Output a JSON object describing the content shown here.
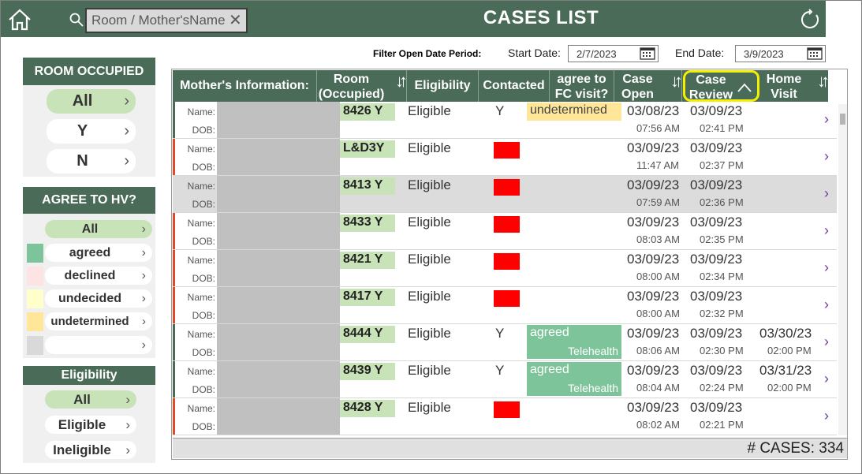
{
  "header": {
    "title": "CASES LIST",
    "search_placeholder": "Room / Mother'sName",
    "clear_glyph": "✕"
  },
  "filters": {
    "date_title": "Filter Open Date Period:",
    "start_label": "Start Date:",
    "start_value": "2/7/2023",
    "end_label": "End Date:",
    "end_value": "3/9/2023"
  },
  "panels": {
    "room": {
      "title": "ROOM OCCUPIED",
      "options": [
        "All",
        "Y",
        "N"
      ],
      "selected": "All"
    },
    "hv": {
      "title": "AGREE TO HV?",
      "options": [
        {
          "label": "All",
          "color": ""
        },
        {
          "label": "agreed",
          "color": "#7ec49a"
        },
        {
          "label": "declined",
          "color": "#fde3e3"
        },
        {
          "label": "undecided",
          "color": "#ffffcc"
        },
        {
          "label": "undetermined",
          "color": "#ffe699"
        },
        {
          "label": "",
          "color": "#d9d9d9"
        }
      ],
      "selected": "All"
    },
    "elig": {
      "title": "Eligibility",
      "options": [
        "All",
        "Eligible",
        "Ineligible"
      ],
      "selected": "All"
    }
  },
  "table": {
    "columns": [
      "Mother's Information:",
      "Room (Occupied)",
      "Eligibility",
      "Contacted",
      "agree to FC visit?",
      "Case Open",
      "Case Review",
      "Home Visit"
    ],
    "name_label": "Name:",
    "dob_label": "DOB:",
    "rows": [
      {
        "room": "8426 Y",
        "elig": "Eligible",
        "contacted": "Y",
        "fc": "undetermined",
        "fc_sub": "",
        "open_d": "03/08/23",
        "open_t": "07:56 AM",
        "rev_d": "03/09/23",
        "rev_t": "02:41 PM",
        "hv_d": "",
        "hv_t": ""
      },
      {
        "room": "L&D3Y",
        "elig": "Eligible",
        "contacted": "red",
        "fc": "",
        "fc_sub": "",
        "open_d": "03/09/23",
        "open_t": "11:47 AM",
        "rev_d": "03/09/23",
        "rev_t": "02:37 PM",
        "hv_d": "",
        "hv_t": ""
      },
      {
        "room": "8413 Y",
        "elig": "Eligible",
        "contacted": "red",
        "fc": "",
        "fc_sub": "",
        "open_d": "03/09/23",
        "open_t": "07:59 AM",
        "rev_d": "03/09/23",
        "rev_t": "02:36 PM",
        "hv_d": "",
        "hv_t": ""
      },
      {
        "room": "8433 Y",
        "elig": "Eligible",
        "contacted": "red",
        "fc": "",
        "fc_sub": "",
        "open_d": "03/09/23",
        "open_t": "08:03 AM",
        "rev_d": "03/09/23",
        "rev_t": "02:35 PM",
        "hv_d": "",
        "hv_t": ""
      },
      {
        "room": "8421 Y",
        "elig": "Eligible",
        "contacted": "red",
        "fc": "",
        "fc_sub": "",
        "open_d": "03/09/23",
        "open_t": "08:00 AM",
        "rev_d": "03/09/23",
        "rev_t": "02:34 PM",
        "hv_d": "",
        "hv_t": ""
      },
      {
        "room": "8417 Y",
        "elig": "Eligible",
        "contacted": "red",
        "fc": "",
        "fc_sub": "",
        "open_d": "03/09/23",
        "open_t": "08:00 AM",
        "rev_d": "03/09/23",
        "rev_t": "02:32 PM",
        "hv_d": "",
        "hv_t": ""
      },
      {
        "room": "8444 Y",
        "elig": "Eligible",
        "contacted": "Y",
        "fc": "agreed",
        "fc_sub": "Telehealth",
        "open_d": "03/09/23",
        "open_t": "08:06 AM",
        "rev_d": "03/09/23",
        "rev_t": "02:30 PM",
        "hv_d": "03/30/23",
        "hv_t": "02:00 PM"
      },
      {
        "room": "8439 Y",
        "elig": "Eligible",
        "contacted": "Y",
        "fc": "agreed",
        "fc_sub": "Telehealth",
        "open_d": "03/09/23",
        "open_t": "08:04 AM",
        "rev_d": "03/09/23",
        "rev_t": "02:24 PM",
        "hv_d": "03/31/23",
        "hv_t": "02:00 PM"
      },
      {
        "room": "8428 Y",
        "elig": "Eligible",
        "contacted": "red",
        "fc": "",
        "fc_sub": "",
        "open_d": "03/09/23",
        "open_t": "08:02 AM",
        "rev_d": "03/09/23",
        "rev_t": "02:21 PM",
        "hv_d": "",
        "hv_t": ""
      }
    ],
    "cases_label": "# CASES: 334"
  },
  "colors": {
    "header_green": "#4a6b58",
    "pill_active": "#c9e3b8",
    "contacted_no": "#ff0000",
    "fc_undetermined": "#ffe699",
    "fc_agreed": "#7ec49a",
    "highlight_ring": "#f5f000"
  }
}
